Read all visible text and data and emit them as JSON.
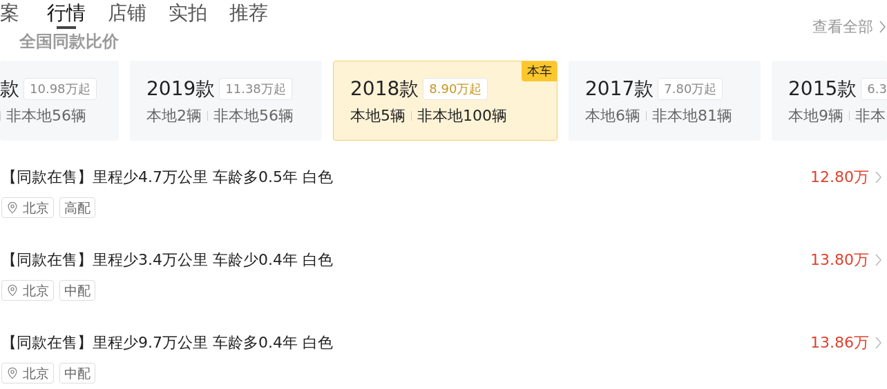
{
  "tabs": [
    {
      "label": "案",
      "selected": false
    },
    {
      "label": "行情",
      "selected": true
    },
    {
      "label": "店铺",
      "selected": false
    },
    {
      "label": "实拍",
      "selected": false
    },
    {
      "label": "推荐",
      "selected": false
    }
  ],
  "section_title": "全国同款比价",
  "view_all": "查看全部",
  "model_years": [
    {
      "year": "款",
      "price": "10.98万起",
      "nonlocal": "非本地56辆",
      "selected": false
    },
    {
      "year": "2019款",
      "price": "11.38万起",
      "local": "本地2辆",
      "nonlocal": "非本地56辆",
      "selected": false
    },
    {
      "year": "2018款",
      "price": "8.90万起",
      "local": "本地5辆",
      "nonlocal": "非本地100辆",
      "selected": true,
      "badge": "本车"
    },
    {
      "year": "2017款",
      "price": "7.80万起",
      "local": "本地6辆",
      "nonlocal": "非本地81辆",
      "selected": false
    },
    {
      "year": "2015款",
      "price": "6.3",
      "local": "本地9辆",
      "nonlocal": "非本",
      "selected": false
    }
  ],
  "listings": [
    {
      "title": "【同款在售】里程少4.7万公里 车龄多0.5年 白色",
      "price": "12.80万",
      "location": "北京",
      "trim": "高配"
    },
    {
      "title": "【同款在售】里程少3.4万公里 车龄少0.4年 白色",
      "price": "13.80万",
      "location": "北京",
      "trim": "中配"
    },
    {
      "title": "【同款在售】里程少9.7万公里 车龄多0.4年 白色",
      "price": "13.86万",
      "location": "北京",
      "trim": "中配"
    }
  ]
}
